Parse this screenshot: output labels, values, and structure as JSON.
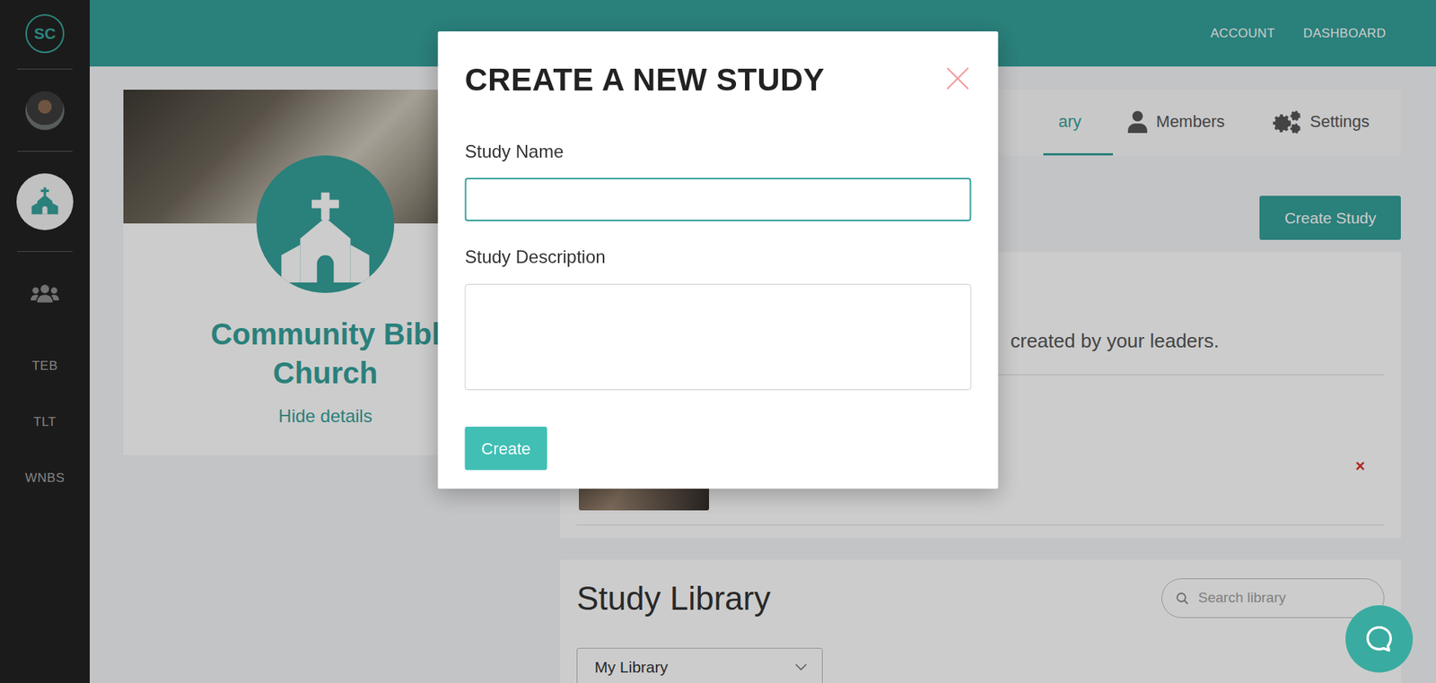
{
  "sidebar": {
    "logo": "SC",
    "nav": [
      {
        "kind": "avatar",
        "selected": false
      },
      {
        "kind": "church",
        "selected": true
      },
      {
        "kind": "people",
        "selected": false
      }
    ],
    "groups": [
      {
        "label": "TEB",
        "selected": false
      },
      {
        "label": "TLT",
        "selected": false
      },
      {
        "label": "WNBS",
        "selected": false
      }
    ]
  },
  "topbar": {
    "links": [
      "ACCOUNT",
      "DASHBOARD"
    ]
  },
  "church": {
    "name_lines": [
      "Community Bibl",
      "Church"
    ],
    "toggle": "Hide details"
  },
  "tabs": [
    {
      "label": "ary",
      "selected": true
    },
    {
      "label": "Members",
      "selected": false
    },
    {
      "label": "Settings",
      "selected": false
    }
  ],
  "create_button": "Create Study",
  "leader_studies": {
    "subtitle": "created by your leaders.",
    "rows": [
      {
        "remove": "×"
      }
    ]
  },
  "library": {
    "title": "Study Library",
    "search": {
      "placeholder": "Search library"
    },
    "filter": "My Library"
  },
  "modal": {
    "title": "CREATE A NEW STUDY",
    "fields": [
      {
        "label": "Study Name",
        "kind": "input",
        "value": "",
        "focused": true
      },
      {
        "label": "Study Description",
        "kind": "textarea",
        "value": "",
        "focused": false
      }
    ],
    "submit": "Create"
  }
}
